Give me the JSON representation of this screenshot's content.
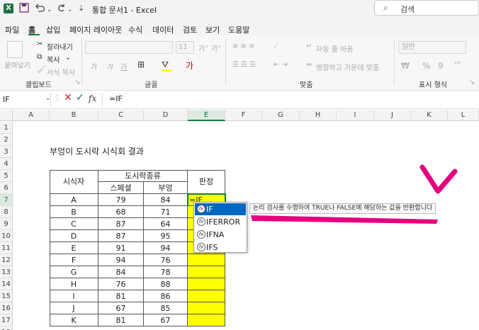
{
  "titlebar": {
    "app_icon": "X",
    "title": "통합 문서1  -  Excel",
    "search_placeholder": "검색",
    "save_icon": "save-icon",
    "undo_icon": "undo-icon",
    "redo_icon": "redo-icon"
  },
  "menu": [
    "파일",
    "홈",
    "삽입",
    "페이지 레이아웃",
    "수식",
    "데이터",
    "검토",
    "보기",
    "도움말"
  ],
  "ribbon": {
    "clipboard": {
      "paste": "붙여넣기",
      "cut": "잘라내기",
      "copy": "복사",
      "format_painter": "서식 복사",
      "label": "클립보드"
    },
    "font": {
      "size": "11",
      "bold": "가",
      "italic": "가",
      "underline": "가",
      "label": "글꼴"
    },
    "align": {
      "wrap": "자동 줄 바꿈",
      "merge": "병합하고 가운데 맞춤",
      "label": "맞춤"
    },
    "number": {
      "format": "일반",
      "label": "표시 형식"
    }
  },
  "formula_bar": {
    "name_box": "IF",
    "fx": "fx",
    "formula": "=IF"
  },
  "columns": [
    "A",
    "B",
    "C",
    "D",
    "E",
    "F",
    "G",
    "H",
    "I",
    "J",
    "K",
    "L"
  ],
  "rows": [
    "1",
    "2",
    "3",
    "4",
    "5",
    "6",
    "7",
    "8",
    "9",
    "10",
    "11",
    "12",
    "13",
    "14",
    "15",
    "16",
    "17",
    "18"
  ],
  "sheet": {
    "title": "부엉이 도시락 시식회 결과",
    "header_name": "시식자",
    "header_group": "도시락종류",
    "header_sub1": "스페셜",
    "header_sub2": "부엉",
    "header_judge": "판정",
    "active_cell_text": "=IF",
    "data": [
      [
        "A",
        "79",
        "84"
      ],
      [
        "B",
        "68",
        "71"
      ],
      [
        "C",
        "87",
        "64"
      ],
      [
        "D",
        "87",
        "95"
      ],
      [
        "E",
        "91",
        "94"
      ],
      [
        "F",
        "94",
        "76"
      ],
      [
        "G",
        "84",
        "78"
      ],
      [
        "H",
        "76",
        "88"
      ],
      [
        "I",
        "81",
        "86"
      ],
      [
        "J",
        "67",
        "85"
      ],
      [
        "K",
        "81",
        "67"
      ]
    ]
  },
  "autocomplete": {
    "items": [
      "IF",
      "IFERROR",
      "IFNA",
      "IFS"
    ],
    "tooltip": "논리 검사를 수행하여 TRUE나 FALSE에 해당하는 값을 반환합니다"
  },
  "colors": {
    "accent": "#107c41",
    "highlight": "#ffff00",
    "annotation": "#e6007e",
    "selection": "#0067c0"
  }
}
